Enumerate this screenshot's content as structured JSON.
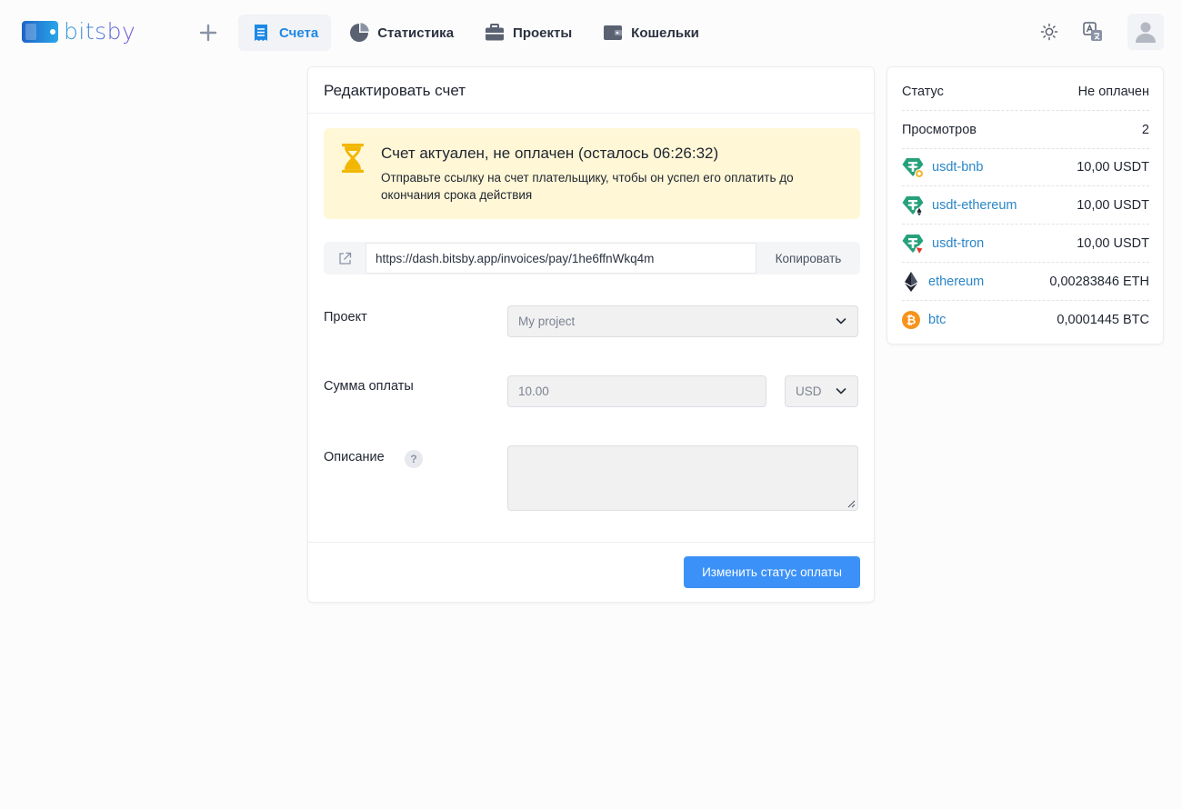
{
  "brand": {
    "name": "bitsby"
  },
  "nav": {
    "items": [
      {
        "label": "Счета",
        "icon": "receipt-icon",
        "active": true
      },
      {
        "label": "Статистика",
        "icon": "pie-chart-icon",
        "active": false
      },
      {
        "label": "Проекты",
        "icon": "briefcase-icon",
        "active": false
      },
      {
        "label": "Кошельки",
        "icon": "wallet-icon",
        "active": false
      }
    ]
  },
  "form": {
    "title": "Редактировать счет",
    "alert": {
      "title": "Счет актуален, не оплачен (осталось 06:26:32)",
      "text": "Отправьте ссылку на счет плательщику, чтобы он успел его оплатить до окончания срока действия",
      "icon": "hourglass-icon",
      "color": "#fff7d6"
    },
    "link": {
      "url": "https://dash.bitsby.app/invoices/pay/1he6ffnWkq4m",
      "copy_label": "Копировать"
    },
    "project": {
      "label": "Проект",
      "value": "My project"
    },
    "amount": {
      "label": "Сумма оплаты",
      "value": "10.00",
      "currency": "USD"
    },
    "description": {
      "label": "Описание",
      "help": "?",
      "value": ""
    },
    "submit_label": "Изменить статус оплаты"
  },
  "summary": {
    "status_label": "Статус",
    "status_value": "Не оплачен",
    "views_label": "Просмотров",
    "views_value": "2",
    "coins": [
      {
        "name": "usdt-bnb",
        "amount": "10,00 USDT",
        "icon": "tether-bnb-icon"
      },
      {
        "name": "usdt-ethereum",
        "amount": "10,00 USDT",
        "icon": "tether-ethereum-icon"
      },
      {
        "name": "usdt-tron",
        "amount": "10,00 USDT",
        "icon": "tether-tron-icon"
      },
      {
        "name": "ethereum",
        "amount": "0,00283846 ETH",
        "icon": "ethereum-icon"
      },
      {
        "name": "btc",
        "amount": "0,0001445 BTC",
        "icon": "bitcoin-icon"
      }
    ]
  },
  "colors": {
    "accent": "#1e88e5",
    "button": "#3b91f7",
    "link": "#2a86c8",
    "tether": "#26a17b",
    "bitcoin": "#f7931a"
  }
}
